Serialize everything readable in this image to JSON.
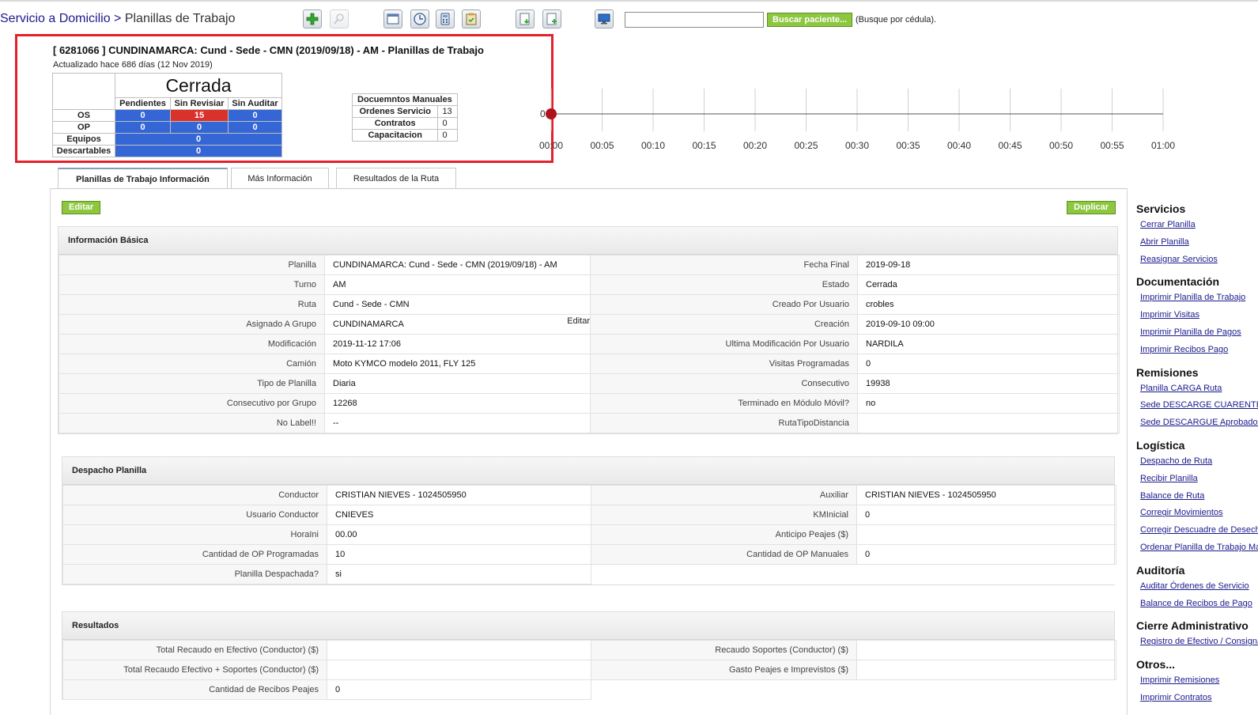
{
  "header": {
    "breadcrumb_link": "Servicio a Domicilio",
    "breadcrumb_sep": " > ",
    "breadcrumb_current": "Planillas de Trabajo",
    "search_placeholder": "",
    "search_button": "Buscar paciente...",
    "search_hint": "(Busque por cédula).",
    "toolbar_icons": [
      "add-icon",
      "search-disabled-icon",
      "window-icon",
      "clock-icon",
      "calculator-icon",
      "clipboard-icon",
      "export-down-icon",
      "export-add-icon",
      "monitor-icon"
    ]
  },
  "summary": {
    "title": "[ 6281066 ] CUNDINAMARCA: Cund - Sede - CMN (2019/09/18) - AM - Planillas de Trabajo",
    "subtitle": "Actualizado hace 686 días (12 Nov 2019)",
    "status": "Cerrada",
    "columns": [
      "Pendientes",
      "Sin Revisiar",
      "Sin Auditar"
    ],
    "rows": [
      {
        "label": "OS",
        "values": [
          "0",
          "15",
          "0"
        ]
      },
      {
        "label": "OP",
        "values": [
          "0",
          "0",
          "0"
        ]
      },
      {
        "label": "Equipos",
        "value": "0"
      },
      {
        "label": "Descartables",
        "value": "0"
      }
    ],
    "docs_title": "Docuemntos Manuales",
    "docs": [
      {
        "label": "Ordenes Servicio",
        "value": "13"
      },
      {
        "label": "Contratos",
        "value": "0"
      },
      {
        "label": "Capacitacion",
        "value": "0"
      }
    ]
  },
  "timeline": {
    "y_label": "0",
    "ticks": [
      "00:00",
      "00:05",
      "00:10",
      "00:15",
      "00:20",
      "00:25",
      "00:30",
      "00:35",
      "00:40",
      "00:45",
      "00:50",
      "00:55",
      "01:00"
    ],
    "marker": "00:00",
    "marker_color": "#b0121b"
  },
  "tabs": [
    "Planillas de Trabajo Información",
    "Más Información",
    "Resultados de la Ruta"
  ],
  "buttons": {
    "edit": "Editar",
    "duplicate": "Duplicar"
  },
  "basic": {
    "title": "Información Básica",
    "inline_edit": "Editar",
    "rows": [
      [
        "Planilla",
        "CUNDINAMARCA: Cund - Sede - CMN (2019/09/18) - AM",
        "Fecha Final",
        "2019-09-18"
      ],
      [
        "Turno",
        "AM",
        "Estado",
        "Cerrada"
      ],
      [
        "Ruta",
        "Cund - Sede - CMN",
        "Creado Por Usuario",
        "crobles"
      ],
      [
        "Asignado A Grupo",
        "CUNDINAMARCA",
        "Creación",
        "2019-09-10 09:00"
      ],
      [
        "Modificación",
        "2019-11-12 17:06",
        "Ultima Modificación Por Usuario",
        "NARDILA"
      ],
      [
        "Camión",
        "Moto KYMCO modelo 2011, FLY 125",
        "Visitas Programadas",
        "0"
      ],
      [
        "Tipo de Planilla",
        "Diaria",
        "Consecutivo",
        "19938"
      ],
      [
        "Consecutivo por Grupo",
        "12268",
        "Terminado en Módulo Móvil?",
        "no"
      ],
      [
        "No Label!!",
        "--",
        "RutaTipoDistancia",
        ""
      ]
    ]
  },
  "despacho": {
    "title": "Despacho Planilla",
    "rows": [
      [
        "Conductor",
        "CRISTIAN NIEVES - 1024505950",
        "Auxiliar",
        "CRISTIAN NIEVES - 1024505950"
      ],
      [
        "Usuario Conductor",
        "CNIEVES",
        "KMInicial",
        "0"
      ],
      [
        "HoraIni",
        "00.00",
        "Anticipo Peajes ($)",
        ""
      ],
      [
        "Cantidad de OP Programadas",
        "10",
        "Cantidad de OP Manuales",
        "0"
      ],
      [
        "Planilla Despachada?",
        "si"
      ]
    ]
  },
  "resultados": {
    "title": "Resultados",
    "rows": [
      [
        "Total Recaudo en Efectivo (Conductor) ($)",
        "",
        "Recaudo Soportes (Conductor) ($)",
        ""
      ],
      [
        "Total Recaudo Efectivo + Soportes (Conductor) ($)",
        "",
        "Gasto Peajes e Imprevistos ($)",
        ""
      ],
      [
        "Cantidad de Recibos Peajes",
        "0"
      ]
    ]
  },
  "sidebar": [
    {
      "title": "Servicios",
      "links": [
        "Cerrar Planilla",
        "Abrir Planilla",
        "Reasignar Servicios"
      ]
    },
    {
      "title": "Documentación",
      "links": [
        "Imprimir Planilla de Trabajo",
        "Imprimir Visitas",
        "Imprimir Planilla de Pagos",
        "Imprimir Recibos Pago"
      ]
    },
    {
      "title": "Remisiones",
      "links": [
        "Planilla CARGA Ruta",
        "Sede DESCARGE CUARENTENA",
        "Sede DESCARGUE Aprobados"
      ]
    },
    {
      "title": "Logística",
      "links": [
        "Despacho de Ruta",
        "Recibir Planilla",
        "Balance de Ruta",
        "Corregir Movimientos",
        "Corregir Descuadre de Desechables",
        "Ordenar Planilla de Trabajo Manual"
      ]
    },
    {
      "title": "Auditoría",
      "links": [
        "Auditar Órdenes de Servicio",
        "Balance de Recibos de Pago"
      ]
    },
    {
      "title": "Cierre Administrativo",
      "links": [
        "Registro de Efectivo / Consignación"
      ]
    },
    {
      "title": "Otros...",
      "links": [
        "Imprimir Remisiones",
        "Imprimir Contratos"
      ]
    }
  ]
}
